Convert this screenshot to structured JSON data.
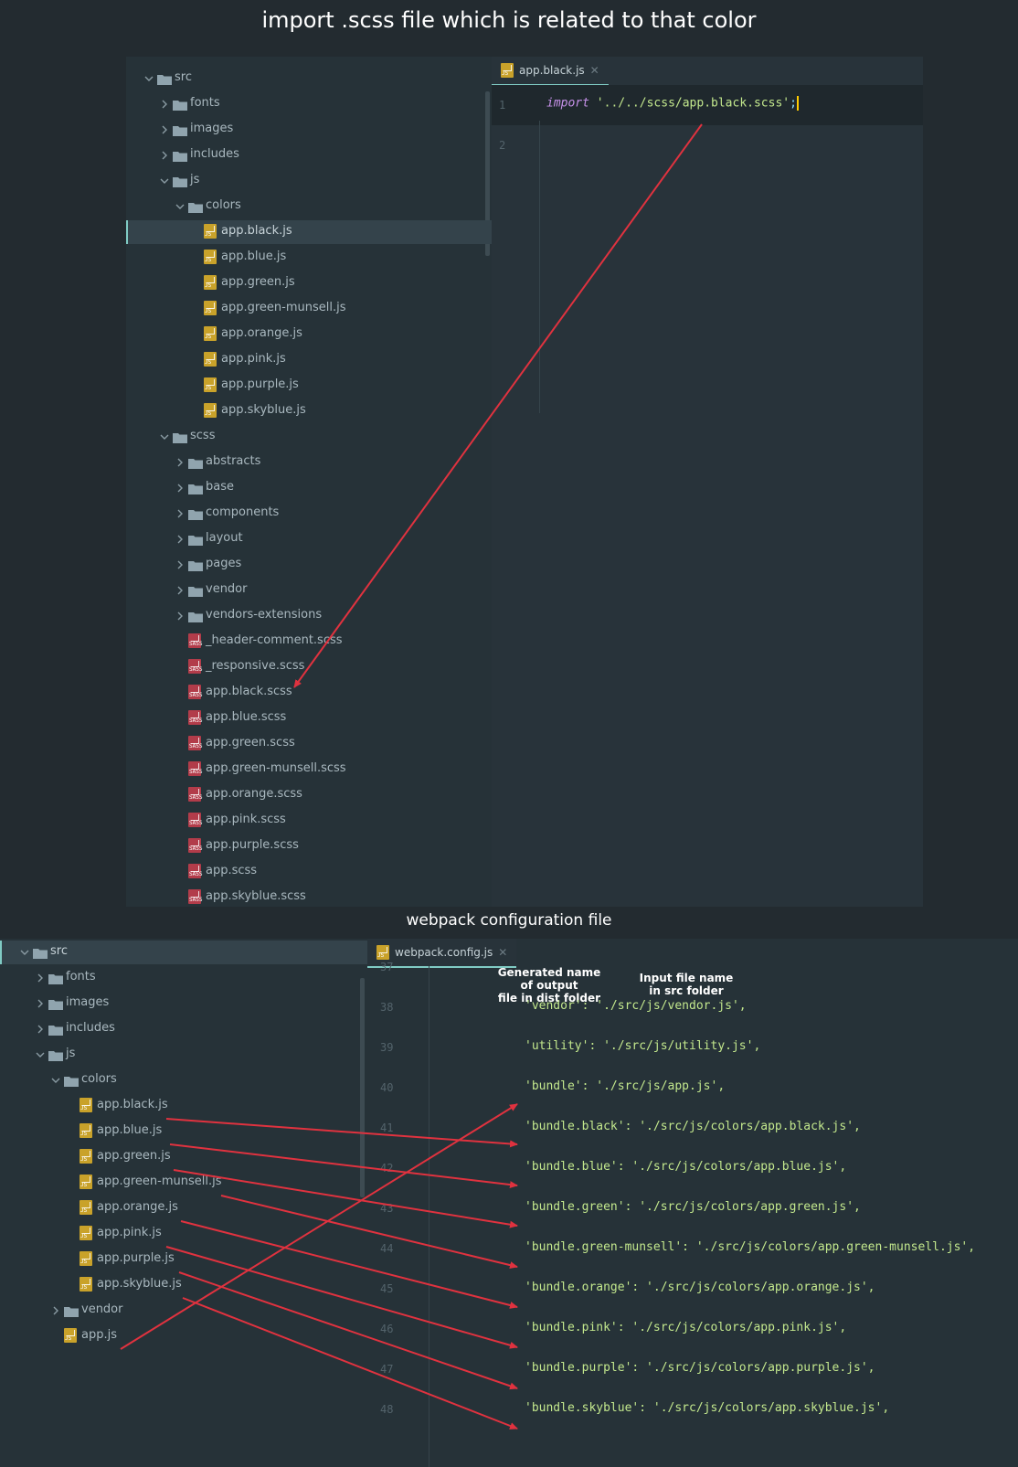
{
  "titles": {
    "top": "import .scss file which is related to that color",
    "bottom": "webpack configuration file"
  },
  "top_tree": [
    {
      "label": "src",
      "type": "folder",
      "open": true
    },
    {
      "label": "fonts",
      "type": "folder",
      "open": false
    },
    {
      "label": "images",
      "type": "folder",
      "open": false
    },
    {
      "label": "includes",
      "type": "folder",
      "open": false
    },
    {
      "label": "js",
      "type": "folder",
      "open": true
    },
    {
      "label": "colors",
      "type": "folder",
      "open": true
    },
    {
      "label": "app.black.js",
      "type": "js",
      "selected": true
    },
    {
      "label": "app.blue.js",
      "type": "js"
    },
    {
      "label": "app.green.js",
      "type": "js"
    },
    {
      "label": "app.green-munsell.js",
      "type": "js"
    },
    {
      "label": "app.orange.js",
      "type": "js"
    },
    {
      "label": "app.pink.js",
      "type": "js"
    },
    {
      "label": "app.purple.js",
      "type": "js"
    },
    {
      "label": "app.skyblue.js",
      "type": "js"
    },
    {
      "label": "scss",
      "type": "folder",
      "open": true
    },
    {
      "label": "abstracts",
      "type": "folder",
      "open": false
    },
    {
      "label": "base",
      "type": "folder",
      "open": false
    },
    {
      "label": "components",
      "type": "folder",
      "open": false
    },
    {
      "label": "layout",
      "type": "folder",
      "open": false
    },
    {
      "label": "pages",
      "type": "folder",
      "open": false
    },
    {
      "label": "vendor",
      "type": "folder",
      "open": false
    },
    {
      "label": "vendors-extensions",
      "type": "folder",
      "open": false
    },
    {
      "label": "_header-comment.scss",
      "type": "sass"
    },
    {
      "label": "_responsive.scss",
      "type": "sass"
    },
    {
      "label": "app.black.scss",
      "type": "sass"
    },
    {
      "label": "app.blue.scss",
      "type": "sass"
    },
    {
      "label": "app.green.scss",
      "type": "sass"
    },
    {
      "label": "app.green-munsell.scss",
      "type": "sass"
    },
    {
      "label": "app.orange.scss",
      "type": "sass"
    },
    {
      "label": "app.pink.scss",
      "type": "sass"
    },
    {
      "label": "app.purple.scss",
      "type": "sass"
    },
    {
      "label": "app.scss",
      "type": "sass"
    },
    {
      "label": "app.skyblue.scss",
      "type": "sass"
    }
  ],
  "top_editor": {
    "tab": "app.black.js",
    "lines": [
      {
        "num": "1",
        "keyword": "import",
        "string": "'../../scss/app.black.scss'",
        "punc": ";"
      },
      {
        "num": "2"
      }
    ]
  },
  "bottom_tree": [
    {
      "label": "src",
      "type": "folder",
      "open": true,
      "selected": true
    },
    {
      "label": "fonts",
      "type": "folder",
      "open": false
    },
    {
      "label": "images",
      "type": "folder",
      "open": false
    },
    {
      "label": "includes",
      "type": "folder",
      "open": false
    },
    {
      "label": "js",
      "type": "folder",
      "open": true
    },
    {
      "label": "colors",
      "type": "folder",
      "open": true
    },
    {
      "label": "app.black.js",
      "type": "js"
    },
    {
      "label": "app.blue.js",
      "type": "js"
    },
    {
      "label": "app.green.js",
      "type": "js"
    },
    {
      "label": "app.green-munsell.js",
      "type": "js"
    },
    {
      "label": "app.orange.js",
      "type": "js"
    },
    {
      "label": "app.pink.js",
      "type": "js"
    },
    {
      "label": "app.purple.js",
      "type": "js"
    },
    {
      "label": "app.skyblue.js",
      "type": "js"
    },
    {
      "label": "vendor",
      "type": "folder",
      "open": false
    },
    {
      "label": "app.js",
      "type": "js"
    }
  ],
  "bottom_editor": {
    "tab": "webpack.config.js",
    "annotations": {
      "output": "Generated name\nof output\nfile in dist folder",
      "input": "Input file name\nin src folder"
    },
    "lines": [
      {
        "num": "37",
        "code": ""
      },
      {
        "num": "38",
        "code": "'vendor': './src/js/vendor.js',"
      },
      {
        "num": "39",
        "code": "'utility': './src/js/utility.js',"
      },
      {
        "num": "40",
        "code": "'bundle': './src/js/app.js',"
      },
      {
        "num": "41",
        "code": "'bundle.black': './src/js/colors/app.black.js',"
      },
      {
        "num": "42",
        "code": "'bundle.blue': './src/js/colors/app.blue.js',"
      },
      {
        "num": "43",
        "code": "'bundle.green': './src/js/colors/app.green.js',"
      },
      {
        "num": "44",
        "code": "'bundle.green-munsell': './src/js/colors/app.green-munsell.js',"
      },
      {
        "num": "45",
        "code": "'bundle.orange': './src/js/colors/app.orange.js',"
      },
      {
        "num": "46",
        "code": "'bundle.pink': './src/js/colors/app.pink.js',"
      },
      {
        "num": "47",
        "code": "'bundle.purple': './src/js/colors/app.purple.js',"
      },
      {
        "num": "48",
        "code": "'bundle.skyblue': './src/js/colors/app.skyblue.js',"
      }
    ]
  },
  "colors": {
    "background": "#232b30",
    "panel": "#263238",
    "accent": "#80cbc4",
    "arrow": "#e0323f",
    "js_badge": "#c9a22a",
    "sass_badge": "#b23c4a"
  }
}
